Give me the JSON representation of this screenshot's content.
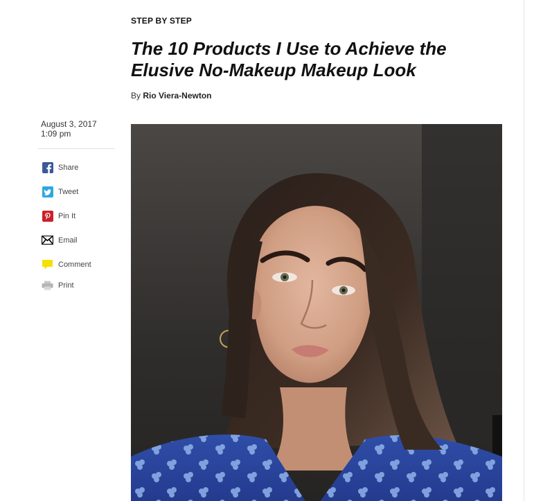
{
  "article": {
    "rubric": "STEP BY STEP",
    "headline": "The 10 Products I Use to Achieve the Elusive No-Makeup Makeup Look",
    "byline_prefix": "By",
    "author": "Rio Viera-Newton",
    "date": "August 3, 2017",
    "time": "1:09 pm"
  },
  "share": {
    "items": [
      {
        "label": "Share",
        "icon": "facebook-icon",
        "color": "#3b5998"
      },
      {
        "label": "Tweet",
        "icon": "twitter-icon",
        "color": "#2ea7e0"
      },
      {
        "label": "Pin It",
        "icon": "pinterest-icon",
        "color": "#cb2027"
      },
      {
        "label": "Email",
        "icon": "envelope-icon",
        "color": "#000000"
      },
      {
        "label": "Comment",
        "icon": "comment-bubble-icon",
        "color": "#f5e000"
      },
      {
        "label": "Print",
        "icon": "printer-icon",
        "color": "#b5b5b5"
      }
    ]
  },
  "hero_image": {
    "subject": "portrait-photo"
  }
}
